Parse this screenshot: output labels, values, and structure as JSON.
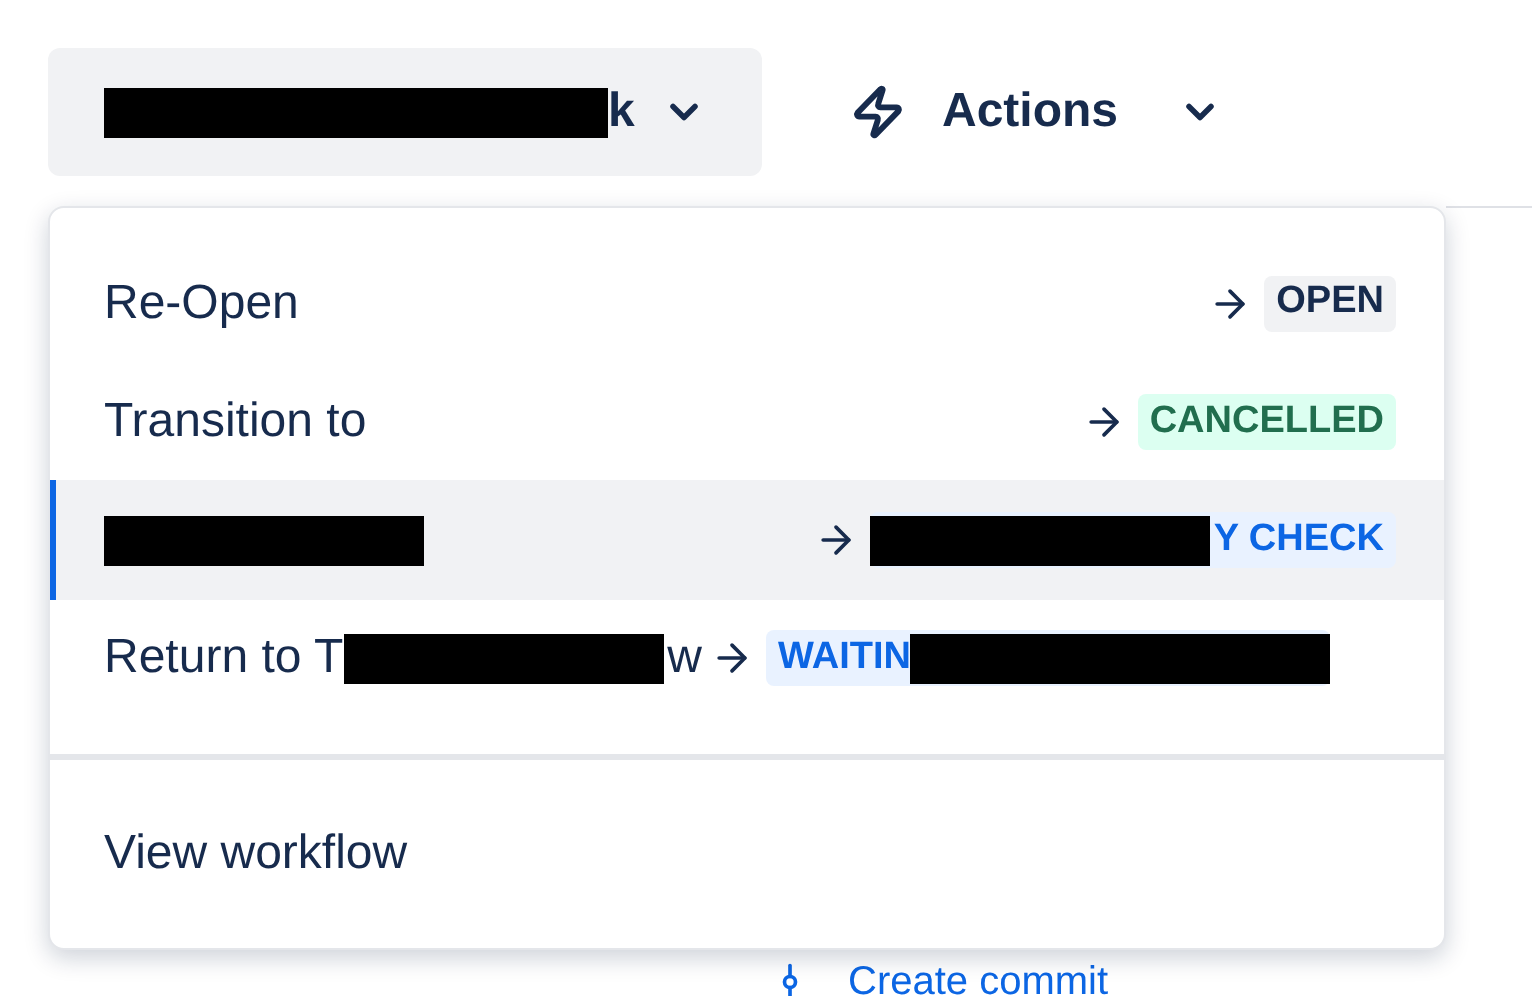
{
  "trigger_button": {
    "label": "k",
    "redacted": true
  },
  "actions_button": {
    "label": "Actions"
  },
  "menu": {
    "items": [
      {
        "label": "Re-Open",
        "status": "OPEN",
        "color": "#172b4d",
        "selected": false
      },
      {
        "label": "Transition to",
        "status": "CANCELLED",
        "color": "#216e4e",
        "selected": false
      },
      {
        "label_redacted": true,
        "status": "Y CHECK",
        "status_redacted_before": true,
        "color": "#0c66e4",
        "selected": true
      },
      {
        "label": "Return to T",
        "label_redacted": true,
        "label_tail": "w",
        "status": "WAITIN",
        "status_redacted_after": true,
        "color": "#0c66e4",
        "selected": false
      }
    ],
    "footer_item": {
      "label": "View workflow"
    }
  },
  "background_link": {
    "label": "Create commit"
  }
}
